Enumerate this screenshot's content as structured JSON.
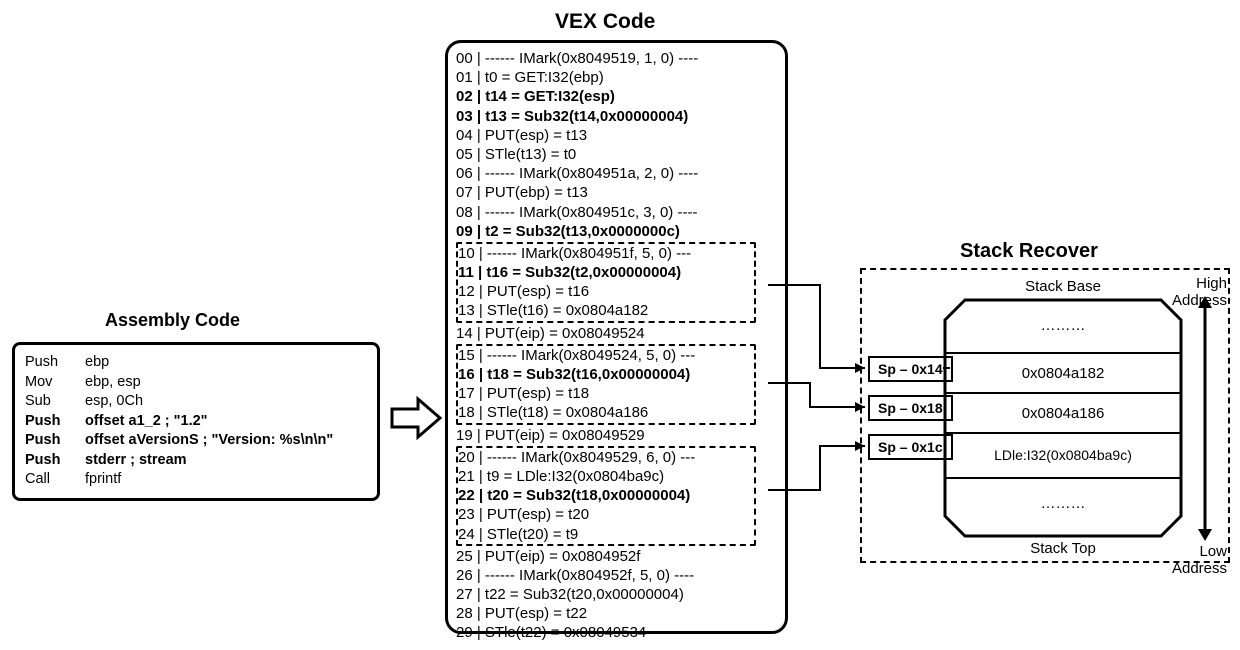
{
  "titles": {
    "assembly": "Assembly Code",
    "vex": "VEX Code",
    "stack": "Stack Recover"
  },
  "assembly": [
    {
      "mn": "Push",
      "op": "ebp",
      "bold": false
    },
    {
      "mn": "Mov",
      "op": "ebp, esp",
      "bold": false
    },
    {
      "mn": "Sub",
      "op": "esp, 0Ch",
      "bold": false
    },
    {
      "mn": "Push",
      "op": "offset a1_2     ; \"1.2\"",
      "bold": true
    },
    {
      "mn": "Push",
      "op": "offset aVersionS ; \"Version: %s\\n\\n\"",
      "bold": true
    },
    {
      "mn": "Push",
      "op": "stderr            ; stream",
      "bold": true
    },
    {
      "mn": "Call",
      "op": "fprintf",
      "bold": false
    }
  ],
  "vex": [
    {
      "n": "00",
      "t": " | ------ IMark(0x8049519, 1, 0) ----",
      "b": false,
      "grp": 0
    },
    {
      "n": "01",
      "t": " | t0 = GET:I32(ebp)",
      "b": false,
      "grp": 0
    },
    {
      "n": "02",
      "t": " | t14 = GET:I32(esp)",
      "b": true,
      "grp": 0
    },
    {
      "n": "03",
      "t": " | t13 = Sub32(t14,0x00000004)",
      "b": true,
      "grp": 0
    },
    {
      "n": "04",
      "t": " | PUT(esp) = t13",
      "b": false,
      "grp": 0
    },
    {
      "n": "05",
      "t": " | STle(t13) = t0",
      "b": false,
      "grp": 0
    },
    {
      "n": "06",
      "t": " | ------ IMark(0x804951a, 2, 0) ----",
      "b": false,
      "grp": 0
    },
    {
      "n": "07",
      "t": " | PUT(ebp) = t13",
      "b": false,
      "grp": 0
    },
    {
      "n": "08",
      "t": " | ------ IMark(0x804951c, 3, 0) ----",
      "b": false,
      "grp": 0
    },
    {
      "n": "09",
      "t": " | t2 = Sub32(t13,0x0000000c)",
      "b": true,
      "grp": 0
    },
    {
      "n": "10",
      "t": " | ------ IMark(0x804951f, 5, 0) ---",
      "b": false,
      "grp": 1
    },
    {
      "n": "11",
      "t": " | t16 = Sub32(t2,0x00000004)",
      "b": true,
      "grp": 1
    },
    {
      "n": "12",
      "t": " | PUT(esp) = t16",
      "b": false,
      "grp": 1
    },
    {
      "n": "13",
      "t": " | STle(t16) = 0x0804a182",
      "b": false,
      "grp": 1
    },
    {
      "n": "14",
      "t": " | PUT(eip) = 0x08049524",
      "b": false,
      "grp": 0
    },
    {
      "n": "15",
      "t": " | ------ IMark(0x8049524, 5, 0) ---",
      "b": false,
      "grp": 2
    },
    {
      "n": "16",
      "t": " | t18 = Sub32(t16,0x00000004)",
      "b": true,
      "grp": 2
    },
    {
      "n": "17",
      "t": " | PUT(esp) = t18",
      "b": false,
      "grp": 2
    },
    {
      "n": "18",
      "t": " | STle(t18) = 0x0804a186",
      "b": false,
      "grp": 2
    },
    {
      "n": "19",
      "t": " | PUT(eip) = 0x08049529",
      "b": false,
      "grp": 0
    },
    {
      "n": "20",
      "t": " | ------ IMark(0x8049529, 6, 0) ---",
      "b": false,
      "grp": 3
    },
    {
      "n": "21",
      "t": " | t9 = LDle:I32(0x0804ba9c)",
      "b": false,
      "grp": 3
    },
    {
      "n": "22",
      "t": " | t20 = Sub32(t18,0x00000004)",
      "b": true,
      "grp": 3
    },
    {
      "n": "23",
      "t": " | PUT(esp) = t20",
      "b": false,
      "grp": 3
    },
    {
      "n": "24",
      "t": " | STle(t20) = t9",
      "b": false,
      "grp": 3
    },
    {
      "n": "25",
      "t": " | PUT(eip) = 0x0804952f",
      "b": false,
      "grp": 0
    },
    {
      "n": "26",
      "t": " | ------ IMark(0x804952f, 5, 0) ----",
      "b": false,
      "grp": 0
    },
    {
      "n": "27",
      "t": " | t22 = Sub32(t20,0x00000004)",
      "b": false,
      "grp": 0
    },
    {
      "n": "28",
      "t": " | PUT(esp) = t22",
      "b": false,
      "grp": 0
    },
    {
      "n": "29",
      "t": " | STle(t22) = 0x08049534",
      "b": false,
      "grp": 0
    }
  ],
  "offsets": {
    "o1": "Sp – 0x14",
    "o2": "Sp – 0x18",
    "o3": "Sp – 0x1c"
  },
  "stack": {
    "base_label": "Stack Base",
    "top_label": "Stack Top",
    "high": "High Address",
    "low": "Low Address",
    "cells": [
      "………",
      "0x0804a182",
      "0x0804a186",
      "LDle:I32(0x0804ba9c)",
      "………"
    ]
  }
}
